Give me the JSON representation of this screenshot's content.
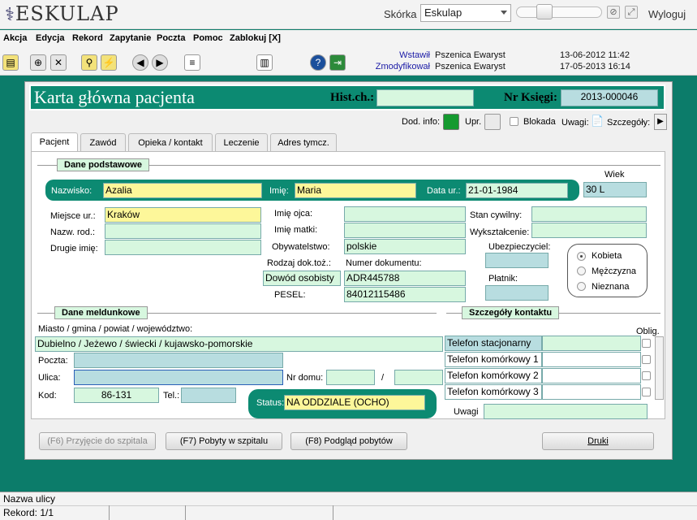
{
  "app": {
    "logo_text": "ESKULAP",
    "skin_label": "Skórka",
    "skin_value": "Eskulap",
    "logout": "Wyloguj"
  },
  "menu": [
    "Akcja",
    "Edycja",
    "Rekord",
    "Zapytanie",
    "Poczta",
    "Pomoc",
    "Zablokuj [X]"
  ],
  "audit": {
    "inserted_label": "Wstawił",
    "inserted_by": "Pszenica Ewaryst",
    "inserted_at": "13-06-2012 11:42",
    "modified_label": "Zmodyfikował",
    "modified_by": "Pszenica Ewaryst",
    "modified_at": "17-05-2013 16:14"
  },
  "header": {
    "title": "Karta główna pacjenta",
    "hist_label": "Hist.ch.:",
    "hist_value": "",
    "nr_label": "Nr Księgi:",
    "nr_value": "2013-000046"
  },
  "flags": {
    "dod_info": "Dod. info:",
    "upr": "Upr.",
    "blokada": "Blokada",
    "uwagi": "Uwagi:",
    "szczegoly": "Szczegóły:"
  },
  "tabs": [
    "Pacjent",
    "Zawód",
    "Opieka / kontakt",
    "Leczenie",
    "Adres tymcz."
  ],
  "basic": {
    "section": "Dane podstawowe",
    "wiek_label": "Wiek",
    "wiek": "30 L",
    "nazwisko_label": "Nazwisko:",
    "nazwisko": "Azalia",
    "imie_label": "Imię:",
    "imie": "Maria",
    "data_ur_label": "Data ur.:",
    "data_ur": "21-01-1984",
    "miejsce_label": "Miejsce ur.:",
    "miejsce": "Kraków",
    "nazw_rod_label": "Nazw. rod.:",
    "nazw_rod": "",
    "drugie_label": "Drugie imię:",
    "drugie": "",
    "imie_ojca_label": "Imię ojca:",
    "imie_ojca": "",
    "imie_matki_label": "Imię matki:",
    "imie_matki": "",
    "obyw_label": "Obywatelstwo:",
    "obyw": "polskie",
    "rodzaj_label": "Rodzaj dok.toż.:",
    "rodzaj": "Dowód osobisty",
    "numer_label": "Numer dokumentu:",
    "numer": "ADR445788",
    "pesel_label": "PESEL:",
    "pesel": "84012115486",
    "stan_label": "Stan cywilny:",
    "stan": "",
    "wyk_label": "Wykształcenie:",
    "wyk": "",
    "ubez_label": "Ubezpieczyciel:",
    "ubez": "",
    "platnik_label": "Płatnik:",
    "platnik": "",
    "sex": [
      "Kobieta",
      "Mężczyzna",
      "Nieznana"
    ],
    "sex_selected": "Kobieta"
  },
  "address": {
    "section": "Dane meldunkowe",
    "miasto_label": "Miasto / gmina / powiat / województwo:",
    "miasto": "Dubielno / Jeżewo / świecki / kujawsko-pomorskie",
    "poczta_label": "Poczta:",
    "poczta": "",
    "ulica_label": "Ulica:",
    "ulica": "",
    "nr_domu_label": "Nr domu:",
    "nr_domu": "",
    "slash": "/",
    "nr_lok": "",
    "kod_label": "Kod:",
    "kod": "86-131",
    "tel_label": "Tel.:",
    "tel": "",
    "status_label": "Status:",
    "status": "NA ODDZIALE (OCHO)"
  },
  "contact": {
    "section": "Szczegóły kontaktu",
    "oblig": "Oblig.",
    "rows": [
      "Telefon stacjonarny",
      "Telefon komórkowy 1",
      "Telefon komórkowy 2",
      "Telefon komórkowy 3"
    ],
    "uwagi_label": "Uwagi",
    "uwagi": ""
  },
  "buttons": {
    "f6": "(F6) Przyjęcie do szpitala",
    "f7": "(F7) Pobyty w szpitalu",
    "f8": "(F8) Podgląd pobytów",
    "druki": "Druki"
  },
  "status": {
    "line1": "Nazwa ulicy",
    "line2": "Rekord: 1/1"
  }
}
